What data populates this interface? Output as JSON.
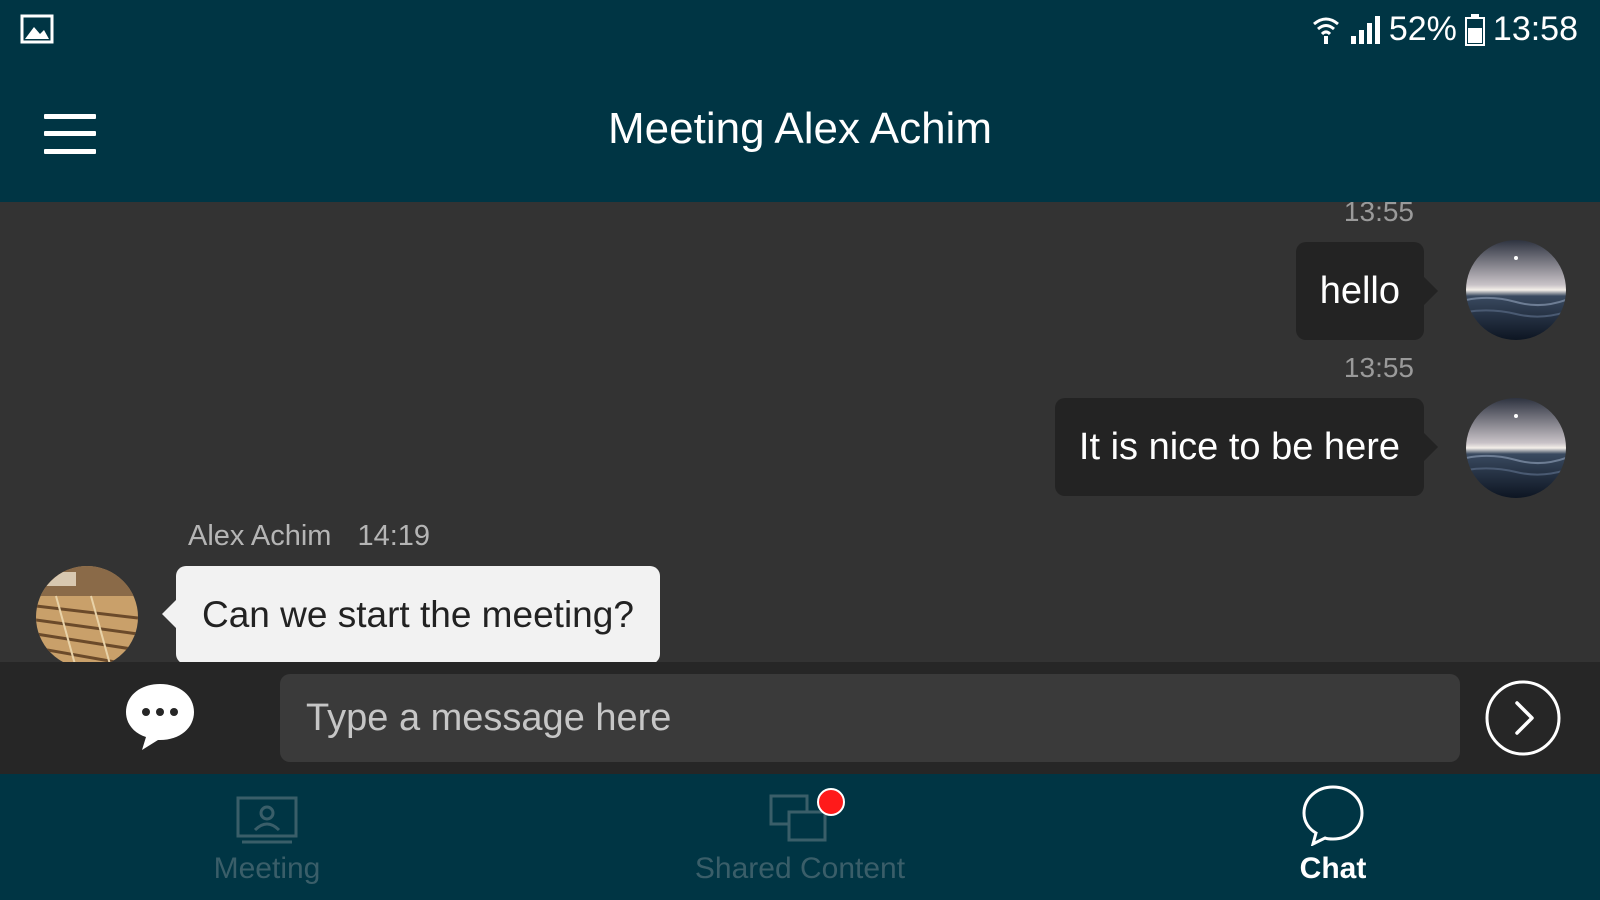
{
  "status_bar": {
    "battery": "52%",
    "time": "13:58",
    "icons": [
      "gallery-icon",
      "wifi-icon",
      "signal-icon",
      "battery-icon"
    ]
  },
  "app_bar": {
    "title": "Meeting Alex Achim",
    "menu_icon": "menu-icon"
  },
  "messages": [
    {
      "direction": "outgoing",
      "time": "13:55",
      "text": "hello"
    },
    {
      "direction": "outgoing",
      "time": "13:55",
      "text": "It is nice to be here"
    },
    {
      "direction": "incoming",
      "sender": "Alex Achim",
      "time": "14:19",
      "text": "Can we start the meeting?"
    }
  ],
  "composer": {
    "placeholder": "Type a message here",
    "emoji_icon": "chat-bubble-dots-icon",
    "send_icon": "send-chevron-icon"
  },
  "bottom_nav": {
    "items": [
      {
        "label": "Meeting",
        "icon": "meeting-screen-icon",
        "active": false
      },
      {
        "label": "Shared Content",
        "icon": "shared-content-icon",
        "active": false,
        "badge": true
      },
      {
        "label": "Chat",
        "icon": "chat-icon",
        "active": true
      }
    ]
  },
  "colors": {
    "bar_background": "#003544",
    "chat_background": "#333333",
    "outgoing_bubble": "#232323",
    "incoming_bubble": "#f2f2f2",
    "badge": "#ff1a1a",
    "inactive_nav": "#3a5e69"
  }
}
